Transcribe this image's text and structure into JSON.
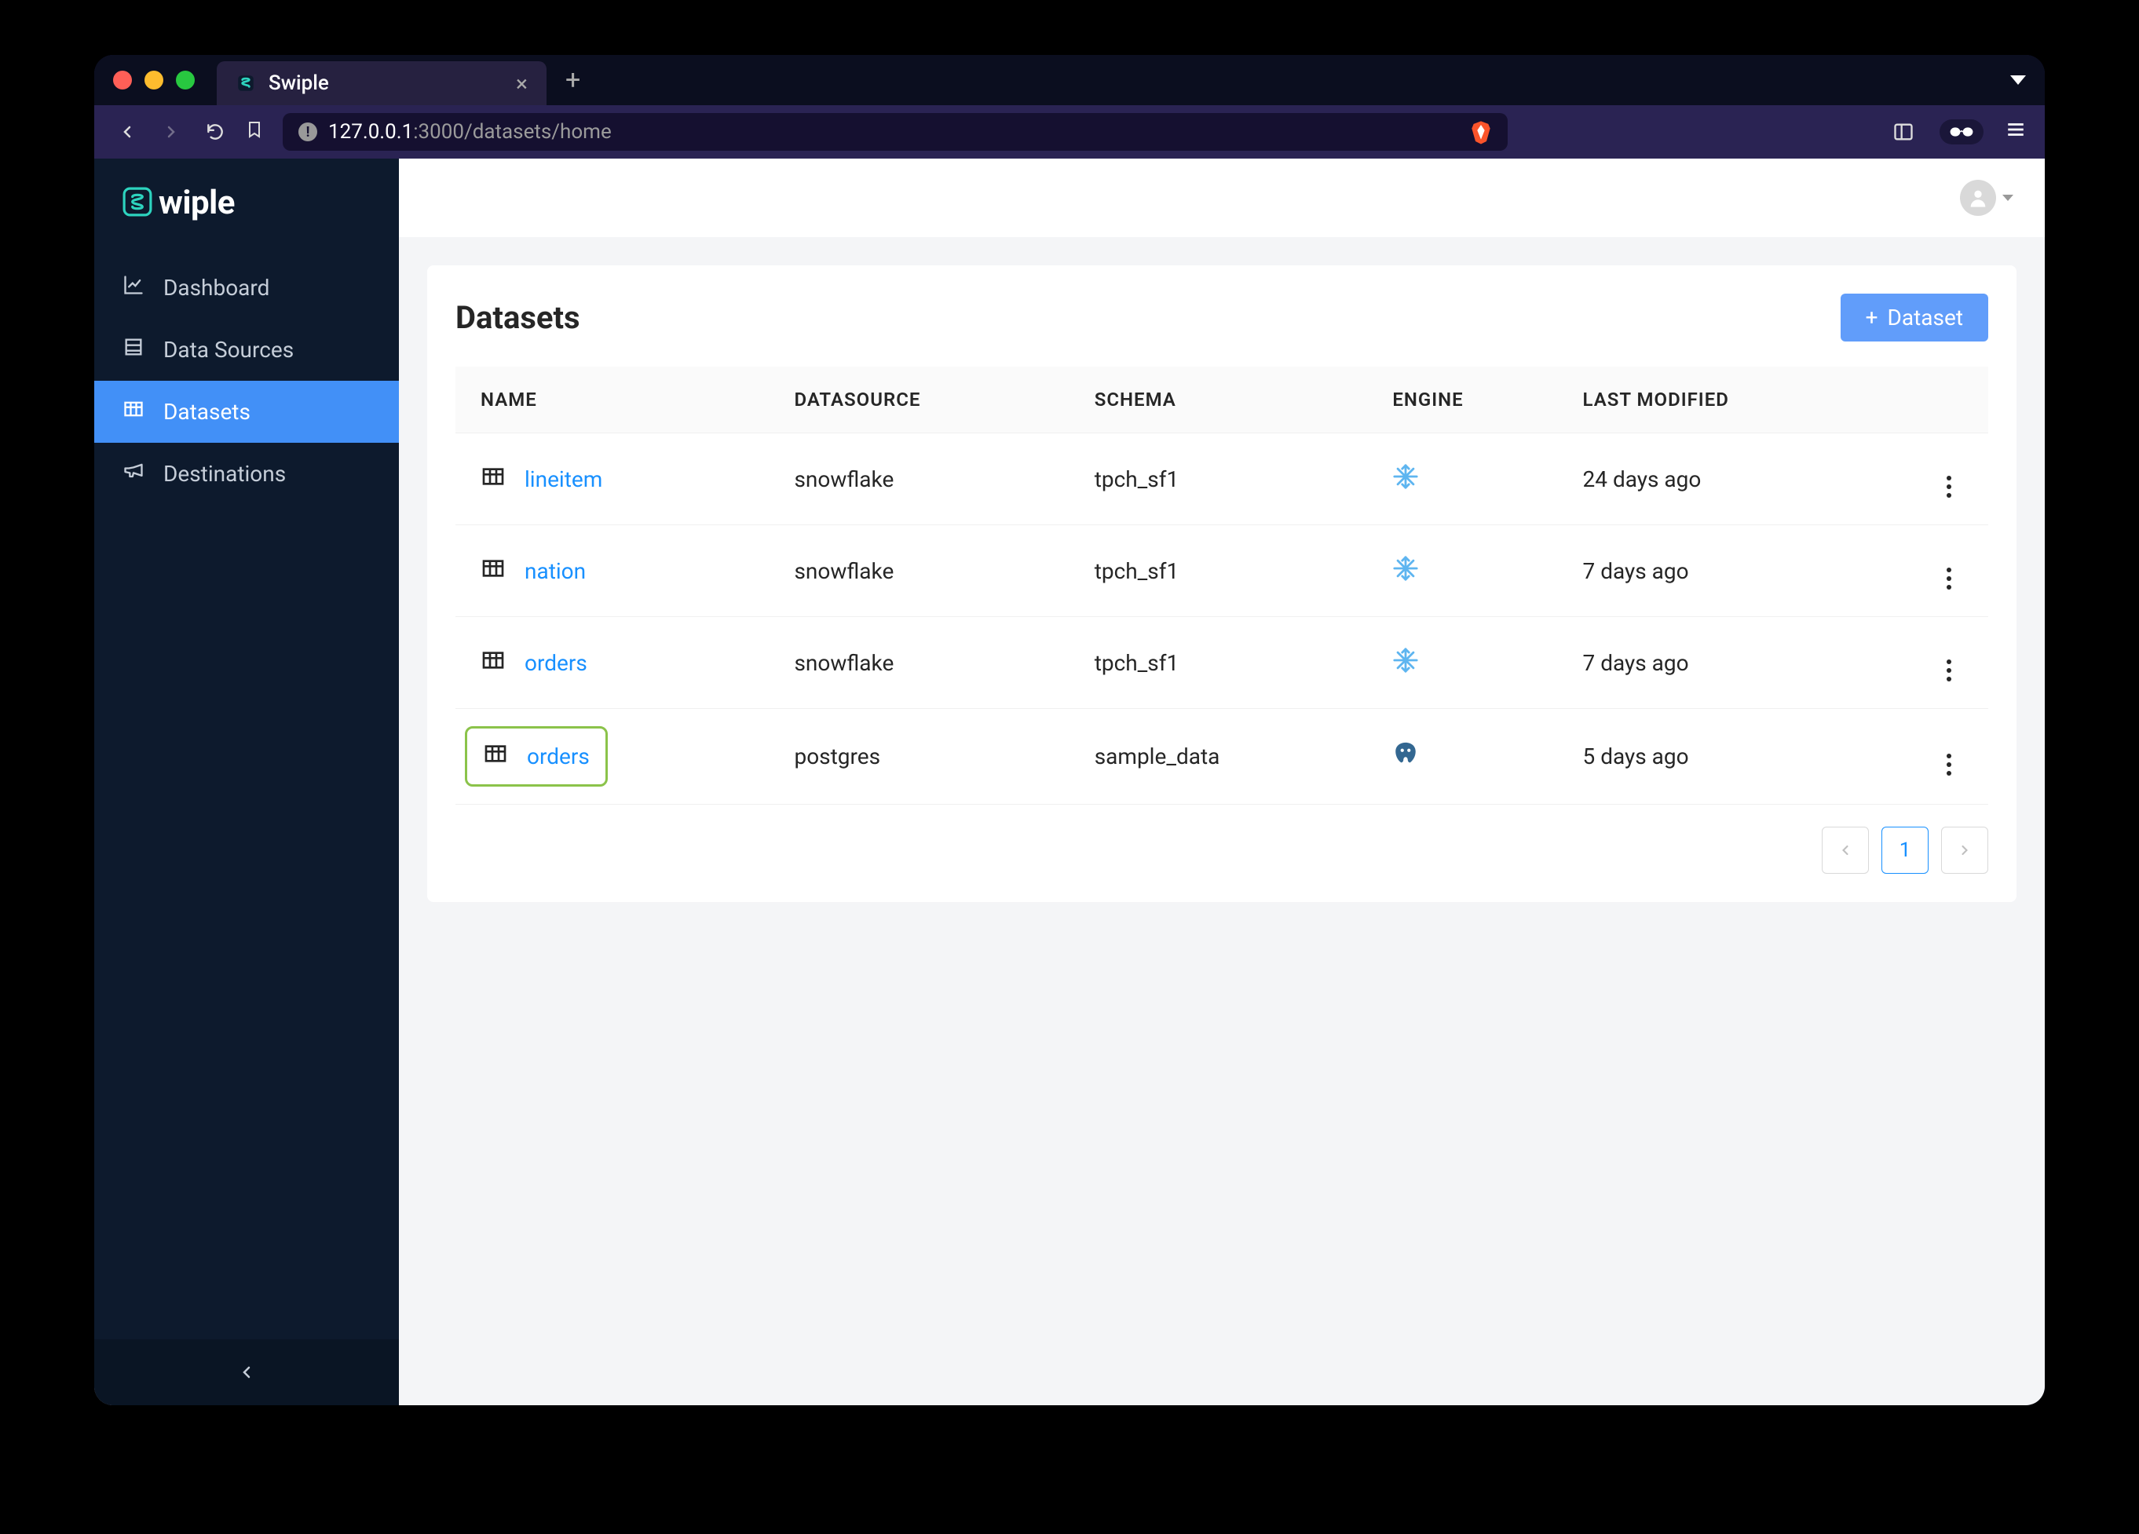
{
  "browser": {
    "tab_title": "Swiple",
    "url": {
      "host": "127.0.0.1",
      "rest": ":3000/datasets/home"
    }
  },
  "app": {
    "logo_text": "wiple"
  },
  "sidebar": {
    "items": [
      {
        "label": "Dashboard",
        "icon": "chart-line",
        "active": false
      },
      {
        "label": "Data Sources",
        "icon": "database",
        "active": false
      },
      {
        "label": "Datasets",
        "icon": "grid",
        "active": true
      },
      {
        "label": "Destinations",
        "icon": "megaphone",
        "active": false
      }
    ]
  },
  "page": {
    "title": "Datasets",
    "add_button_label": "Dataset"
  },
  "table": {
    "columns": [
      "NAME",
      "DATASOURCE",
      "SCHEMA",
      "ENGINE",
      "LAST MODIFIED"
    ],
    "rows": [
      {
        "name": "lineitem",
        "datasource": "snowflake",
        "schema": "tpch_sf1",
        "engine": "snowflake",
        "last_modified": "24 days ago",
        "highlighted": false
      },
      {
        "name": "nation",
        "datasource": "snowflake",
        "schema": "tpch_sf1",
        "engine": "snowflake",
        "last_modified": "7 days ago",
        "highlighted": false
      },
      {
        "name": "orders",
        "datasource": "snowflake",
        "schema": "tpch_sf1",
        "engine": "snowflake",
        "last_modified": "7 days ago",
        "highlighted": false
      },
      {
        "name": "orders",
        "datasource": "postgres",
        "schema": "sample_data",
        "engine": "postgres",
        "last_modified": "5 days ago",
        "highlighted": true
      }
    ]
  },
  "pagination": {
    "current": "1"
  }
}
